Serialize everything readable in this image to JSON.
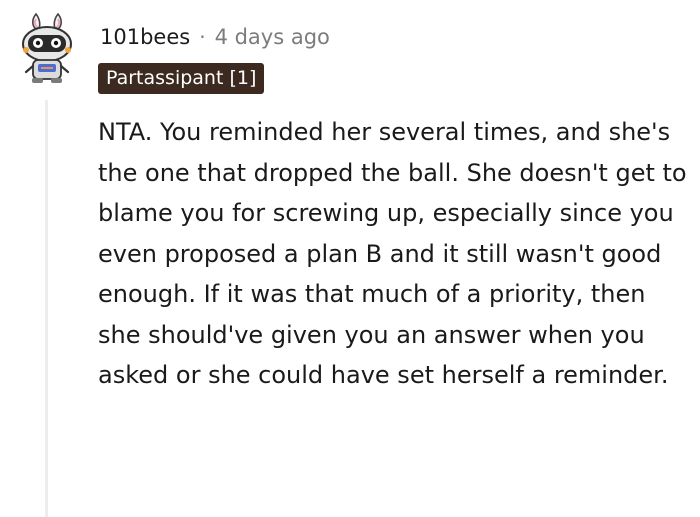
{
  "comment": {
    "username": "101bees",
    "separator": "·",
    "timestamp": "4 days ago",
    "flair": "Partassipant [1]",
    "body": "NTA. You reminded her several times, and she's the one that dropped the ball. She doesn't get to blame you for screwing up, especially since you even proposed a plan B and it still wasn't good enough. If it was that much of a priority, then she should've given you an answer when you asked or she could have set herself a reminder.",
    "avatar_icon": "snoo-robot-avatar-icon"
  },
  "colors": {
    "flair_bg": "#3c2a20",
    "flair_text": "#ffffff",
    "meta_text": "#7c7c7c",
    "thread_line": "#ededed"
  }
}
